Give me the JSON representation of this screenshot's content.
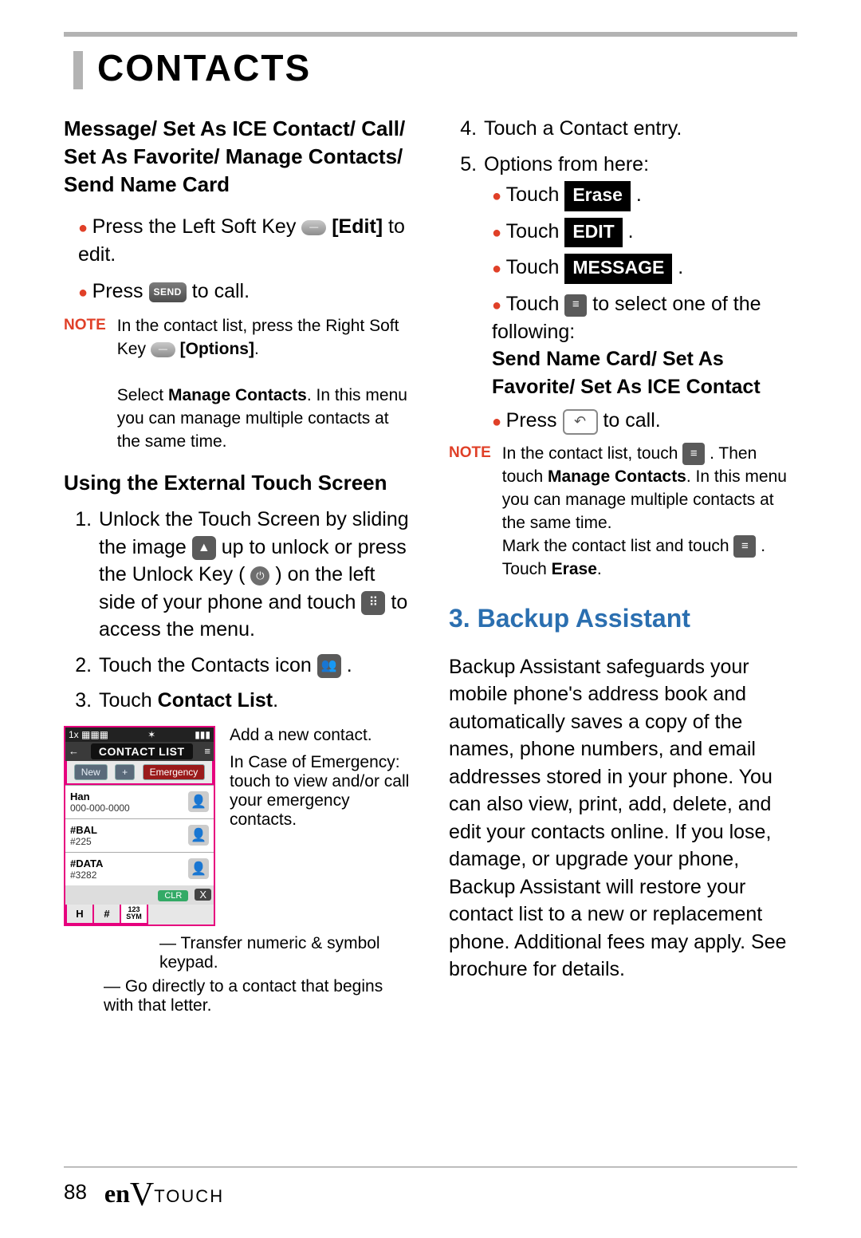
{
  "header": {
    "title": "CONTACTS"
  },
  "col1": {
    "leadin": "Message/ Set As ICE Contact/ Call/ Set As Favorite/ Manage Contacts/ Send Name Card",
    "bullet1_pre": "Press the Left Soft Key ",
    "bullet1_post_bold": "[Edit]",
    "bullet1_tail": " to edit.",
    "bullet2_pre": "Press ",
    "bullet2_mid": "SEND",
    "bullet2_tail": " to call.",
    "note1_label": "NOTE",
    "note1_line1_pre": "In the contact list, press the Right Soft Key ",
    "note1_line1_bold": "[Options]",
    "note1_line1_post": ".",
    "note1_line2_pre": "Select ",
    "note1_line2_bold": "Manage Contacts",
    "note1_line2_post": ". In this menu you can manage multiple contacts at the same time.",
    "subhead": "Using the External Touch Screen",
    "step1_a": "Unlock the Touch Screen by sliding the image ",
    "step1_b": " up to unlock or press the Unlock Key ( ",
    "step1_c": " ) on the left side of your phone and touch ",
    "step1_d": " to access the menu.",
    "step2_pre": "Touch the Contacts icon ",
    "step2_post": " .",
    "step3_pre": "Touch ",
    "step3_bold": "Contact List",
    "step3_post": ".",
    "mock": {
      "status_left": "1x ▦▦▦",
      "status_mid": "✶",
      "status_right": "▮▮▮",
      "hdr_back": "←",
      "hdr_title": "CONTACT LIST",
      "hdr_menu": "≡",
      "btn_new": "New",
      "btn_plus": "+",
      "btn_emer": "Emergency",
      "row1_name": "Han",
      "row1_num": "000-000-0000",
      "row2_name": "#BAL",
      "row2_num": "#225",
      "row3_name": "#DATA",
      "row3_num": "#3282",
      "clr": "CLR",
      "x": "X",
      "key_H": "H",
      "key_hash": "#",
      "key_sym1": "123",
      "key_sym2": "SYM"
    },
    "callout_add": "Add a new contact.",
    "callout_ice": "In Case of Emergency: touch to view and/or call your emergency contacts.",
    "callout_sym": "Transfer numeric & symbol keypad.",
    "callout_letter": "Go directly to a contact that begins with that letter."
  },
  "col2": {
    "step4": "Touch a Contact entry.",
    "step5": "Options from here:",
    "sub1_pre": "Touch ",
    "sub1_btn": "Erase",
    "sub1_post": " .",
    "sub2_pre": "Touch ",
    "sub2_btn": "EDIT",
    "sub2_post": " .",
    "sub3_pre": "Touch ",
    "sub3_btn": "MESSAGE",
    "sub3_post": " .",
    "sub4_pre": "Touch ",
    "sub4_mid": " to select one of the following:",
    "sub4_bold": "Send Name Card/ Set As Favorite/ Set As ICE Contact",
    "sub5_pre": "Press ",
    "sub5_post": " to call.",
    "note2_label": "NOTE",
    "note2_a": "In the contact list, touch ",
    "note2_b": " . Then touch ",
    "note2_b_bold": "Manage Contacts",
    "note2_c": ". In this menu you can manage multiple contacts at the same time.",
    "note2_d": "Mark the contact list and touch ",
    "note2_e": " . Touch ",
    "note2_e_bold": "Erase",
    "note2_f": ".",
    "section_title": "3. Backup Assistant",
    "section_body": "Backup Assistant safeguards your mobile phone's address book and automatically saves a copy of the names, phone numbers, and email addresses stored in your phone. You can also view, print, add, delete, and edit your contacts online. If you lose, damage, or upgrade your phone, Backup Assistant will restore your contact list to a new or replacement phone. Additional fees may apply. See brochure for details."
  },
  "footer": {
    "page": "88",
    "brand_en": "en",
    "brand_v": "V",
    "brand_touch": "TOUCH"
  }
}
